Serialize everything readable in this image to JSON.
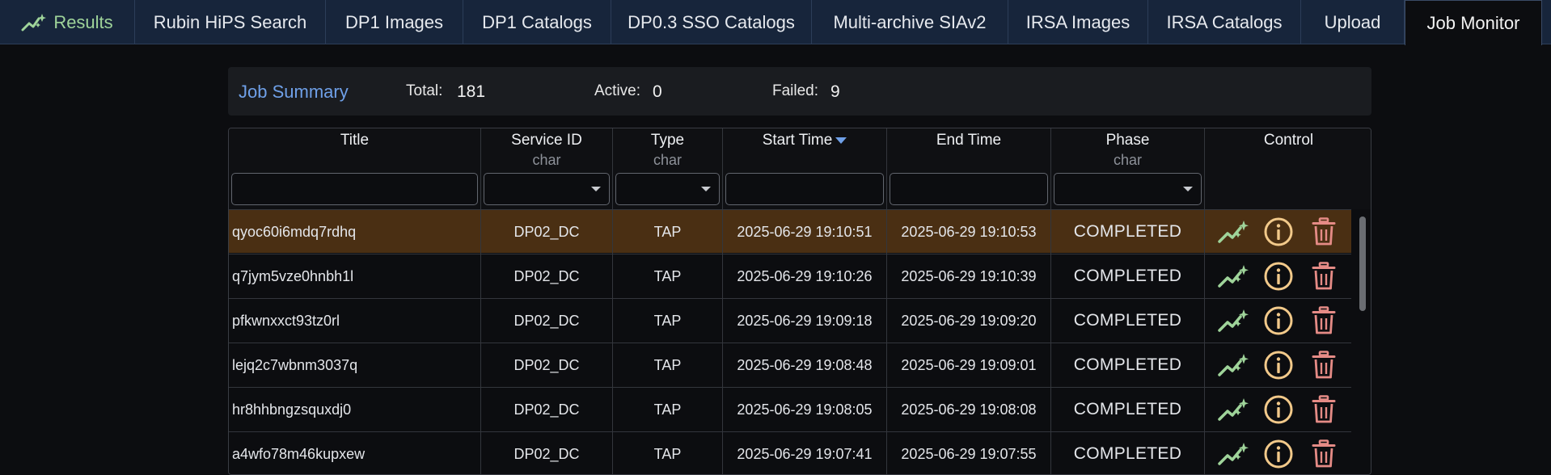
{
  "tabs": [
    {
      "label": "Results",
      "icon": "sparkline-icon"
    },
    {
      "label": "Rubin HiPS Search"
    },
    {
      "label": "DP1 Images"
    },
    {
      "label": "DP1 Catalogs"
    },
    {
      "label": "DP0.3 SSO Catalogs"
    },
    {
      "label": "Multi-archive SIAv2"
    },
    {
      "label": "IRSA Images"
    },
    {
      "label": "IRSA Catalogs"
    },
    {
      "label": "Upload"
    },
    {
      "label": "Job Monitor",
      "active": true
    }
  ],
  "summary": {
    "title": "Job Summary",
    "total_label": "Total:",
    "total": "181",
    "active_label": "Active:",
    "active": "0",
    "failed_label": "Failed:",
    "failed": "9"
  },
  "columns": [
    {
      "title": "Title",
      "sub": "",
      "filter": "text"
    },
    {
      "title": "Service ID",
      "sub": "char",
      "filter": "select"
    },
    {
      "title": "Type",
      "sub": "char",
      "filter": "select"
    },
    {
      "title": "Start Time",
      "sub": "",
      "filter": "text",
      "sorted": "desc"
    },
    {
      "title": "End Time",
      "sub": "",
      "filter": "text"
    },
    {
      "title": "Phase",
      "sub": "char",
      "filter": "select"
    },
    {
      "title": "Control",
      "sub": "",
      "filter": "none"
    }
  ],
  "rows": [
    {
      "title": "qyoc60i6mdq7rdhq",
      "service": "DP02_DC",
      "type": "TAP",
      "start": "2025-06-29 19:10:51",
      "end": "2025-06-29 19:10:53",
      "phase": "COMPLETED",
      "selected": true
    },
    {
      "title": "q7jym5vze0hnbh1l",
      "service": "DP02_DC",
      "type": "TAP",
      "start": "2025-06-29 19:10:26",
      "end": "2025-06-29 19:10:39",
      "phase": "COMPLETED"
    },
    {
      "title": "pfkwnxxct93tz0rl",
      "service": "DP02_DC",
      "type": "TAP",
      "start": "2025-06-29 19:09:18",
      "end": "2025-06-29 19:09:20",
      "phase": "COMPLETED"
    },
    {
      "title": "lejq2c7wbnm3037q",
      "service": "DP02_DC",
      "type": "TAP",
      "start": "2025-06-29 19:08:48",
      "end": "2025-06-29 19:09:01",
      "phase": "COMPLETED"
    },
    {
      "title": "hr8hhbngzsquxdj0",
      "service": "DP02_DC",
      "type": "TAP",
      "start": "2025-06-29 19:08:05",
      "end": "2025-06-29 19:08:08",
      "phase": "COMPLETED"
    },
    {
      "title": "a4wfo78m46kupxew",
      "service": "DP02_DC",
      "type": "TAP",
      "start": "2025-06-29 19:07:41",
      "end": "2025-06-29 19:07:55",
      "phase": "COMPLETED"
    }
  ],
  "colors": {
    "tabbar": "#17253b",
    "selected_row": "#4a2f13",
    "accent": "#6fa0e8",
    "chart_icon": "#9fd49a",
    "info_icon": "#f2c98a",
    "delete_icon": "#e58b86"
  }
}
